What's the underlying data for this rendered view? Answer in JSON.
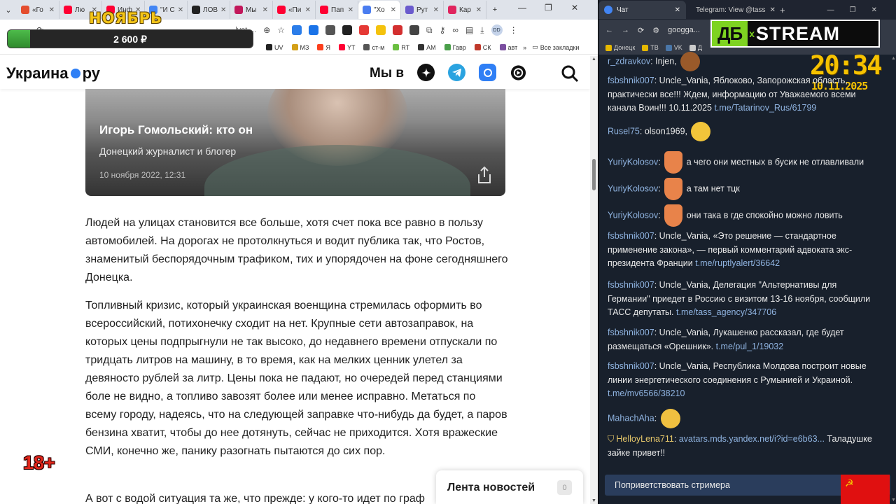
{
  "left_browser": {
    "tabs": [
      {
        "label": "«Го",
        "color": "#e44d2e"
      },
      {
        "label": "Лю",
        "color": "#ff0033"
      },
      {
        "label": "Инф",
        "color": "#ff0033"
      },
      {
        "label": "\"И С",
        "color": "#4285f4"
      },
      {
        "label": "ЛОВ",
        "color": "#222222"
      },
      {
        "label": "Мы",
        "color": "#c2185b"
      },
      {
        "label": "«Пи",
        "color": "#ff0033"
      },
      {
        "label": "Пап",
        "color": "#ff0033"
      },
      {
        "label": "\"Хо",
        "color": "#4a7df0",
        "active": true
      },
      {
        "label": "Рут",
        "color": "#6a5acd"
      },
      {
        "label": "Кар",
        "color": "#e0245e"
      }
    ],
    "tab_close": "✕",
    "new_tab": "+",
    "address": "...lvet-...",
    "bookmarks": [
      {
        "label": "UV",
        "color": "#222222"
      },
      {
        "label": "МЗ",
        "color": "#d4a017"
      },
      {
        "label": "Я",
        "color": "#fc3f1d"
      },
      {
        "label": "YT",
        "color": "#ff0033"
      },
      {
        "label": "ст-м",
        "color": "#555555"
      },
      {
        "label": "RT",
        "color": "#6abf40"
      },
      {
        "label": "АМ",
        "color": "#333333"
      },
      {
        "label": "Гавр",
        "color": "#4a9f4a"
      },
      {
        "label": "СК",
        "color": "#c0392b"
      },
      {
        "label": "авт",
        "color": "#7b4fa0"
      }
    ],
    "bookmarks_more": "»",
    "all_bookmarks": "Все закладки",
    "profile_initials": "DD"
  },
  "overlay": {
    "month": "НОЯБРЬ",
    "amount": "2 600 ₽",
    "progress": 0.09,
    "age_rating": "18+"
  },
  "site": {
    "logo_word": "Украина",
    "logo_suffix": "ру",
    "we_in": "Мы в",
    "card": {
      "title": "Игорь Гомольский: кто он",
      "subtitle": "Донецкий журналист и блогер",
      "date": "10 ноября 2022, 12:31"
    },
    "paragraphs": [
      "Людей на улицах становится все больше, хотя счет пока все равно в пользу автомобилей. На дорогах не протолкнуться и водит публика так, что Ростов, знаменитый беспорядочным трафиком, тих и упорядочен на фоне сегодняшнего Донецка.",
      "Топливный кризис, который украинская военщина стремилась оформить во всероссийский, потихонечку сходит на нет. Крупные сети автозаправок, на которых цены подпрыгнули не так высоко, до недавнего времени отпускали по тридцать литров на машину, в то время, как на мелких ценник улетел за девяносто рублей за литр. Цены пока не падают, но очередей перед станциями боле не видно, а топливо завозят более или менее исправно. Метаться по всему городу, надеясь, что на следующей заправке что-нибудь да будет, а паров бензина хватит, чтобы до нее дотянуть, сейчас не приходится. Хотя вражеские СМИ, конечно же, панику разогнать пытаются до сих пор.",
      "А вот с водой ситуация та же, что прежде: у кого-то идет по граф"
    ],
    "news_feed": {
      "label": "Лента новостей",
      "count": "0"
    }
  },
  "right_browser": {
    "tabs": [
      {
        "label": "Чат",
        "color": "#4285f4",
        "active": true
      },
      {
        "label": "Telegram: View @tass",
        "color": "#2aa3e0"
      }
    ],
    "tab_close": "✕",
    "new_tab": "+",
    "address": "googga...",
    "bookmarks": [
      {
        "label": "Донецк",
        "color": "#e6b800"
      },
      {
        "label": "ТВ",
        "color": "#e6b800"
      },
      {
        "label": "VK",
        "color": "#4a76a8"
      },
      {
        "label": "Д",
        "color": "#cccccc"
      }
    ],
    "overlay_logo": {
      "ab": "ДБ",
      "x": "x",
      "stream": "STREAM"
    },
    "clock": "20:34",
    "date": "10.11.2025",
    "chat": [
      {
        "user": "r_zdravkov",
        "text": "Injen,",
        "emoji": "bear",
        "emoji_color": "#9a5a2a"
      },
      {
        "user": "fsbshnik007",
        "text": "Uncle_Vania, Яблоково, Запорожская область, практически все!!! Ждем, информацию от Уважаемого всеми канала Воин!!! 10.11.2025",
        "link": "t.me/Tatarinov_Rus/61799"
      },
      {
        "user": "Rusel75",
        "text": "olson1969,",
        "emoji": "laugh-emoji",
        "emoji_color": "#f2c53a"
      },
      {
        "user": "YuriyKolosov",
        "text": "а чего они местных в бусик не отлавливали",
        "emoji": "fry-emoji",
        "emoji_color": "#e8834a"
      },
      {
        "user": "YuriyKolosov",
        "text": "а там нет тцк",
        "emoji": "fry-emoji",
        "emoji_color": "#e8834a"
      },
      {
        "user": "YuriyKolosov",
        "text": "они така в где спокойно можно ловить",
        "emoji": "fry-emoji",
        "emoji_color": "#e8834a"
      },
      {
        "user": "fsbshnik007",
        "text": "Uncle_Vania, «Это решение — стандартное применение закона», — первый комментарий адвоката экс-президента Франции",
        "link": "t.me/ruptlyalert/36642"
      },
      {
        "user": "fsbshnik007",
        "text": "Uncle_Vania, Делегация \"Альтернативы для Германии\" приедет в Россию с визитом 13-16 ноября, сообщили ТАСС депутаты.",
        "link": "t.me/tass_agency/347706"
      },
      {
        "user": "fsbshnik007",
        "text": "Uncle_Vania, Лукашенко рассказал, где будет размещаться «Орешник».",
        "link": "t.me/pul_1/19032"
      },
      {
        "user": "fsbshnik007",
        "text": "Uncle_Vania, Республика Молдова построит новые линии энергетического соединения с Румынией и Украиной.",
        "link": "t.me/mv6566/38210"
      },
      {
        "user": "MahachAha",
        "text": "",
        "emoji": "thumbs-emoji",
        "emoji_color": "#f0c040"
      },
      {
        "user": "HelloyLena711",
        "text": "Таладушке зайке привет!!",
        "link": "avatars.mds.yandex.net/i?id=e6b63...",
        "badge": "shield"
      }
    ],
    "greet_button": "Поприветствовать стримера"
  },
  "colors": {
    "chat_bg": "#18202c",
    "username": "#8fb3e0",
    "clock": "#f6c200",
    "green": "#7ed321",
    "brand_dot": "#2f7ff5"
  }
}
